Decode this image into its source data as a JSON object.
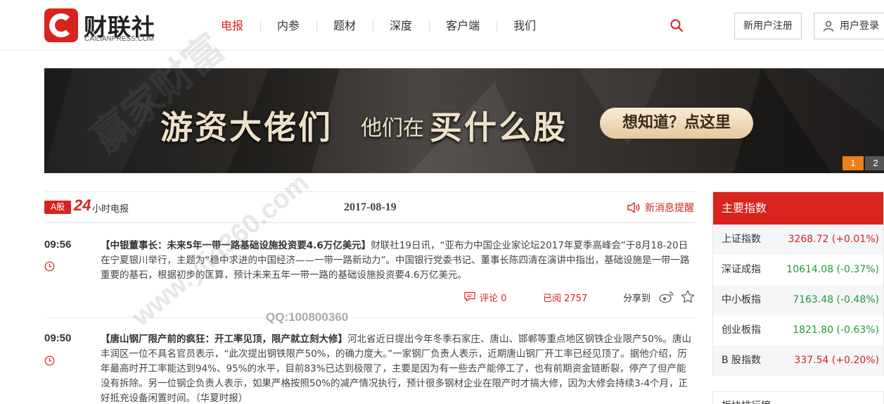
{
  "brand": {
    "name_cn": "财联社",
    "name_en": "CAILIANPRESS.COM",
    "accent": "#d8231e"
  },
  "nav": {
    "items": [
      {
        "label": "电报",
        "active": true
      },
      {
        "label": "内参"
      },
      {
        "label": "题材"
      },
      {
        "label": "深度"
      },
      {
        "label": "客户端"
      },
      {
        "label": "我们"
      }
    ],
    "search_icon": "search-icon",
    "register": "新用户注册",
    "login": "用户登录"
  },
  "banner": {
    "text1": "游资大佬们",
    "text2": "他们在",
    "text3": "买什么股",
    "cta": "想知道？点这里",
    "pages": [
      "1",
      "2"
    ],
    "active_page": 1
  },
  "telegraph": {
    "tag": "A股",
    "tag_num": "24",
    "tag_label": "小时电报",
    "date": "2017-08-19",
    "remind": "新消息提醒"
  },
  "news": [
    {
      "time": "09:56",
      "headline": "【中银董事长：未来5年一带一路基础设施投资要4.6万亿美元】",
      "body": "财联社19日讯，“亚布力中国企业家论坛2017年夏季高峰会”于8月18-20日在宁夏银川举行，主题为“稳中求进的中国经济——一带一路新动力”。中国银行党委书记、董事长陈四清在演讲中指出，基础设施是一带一路重要的基石，根据初步的匡算，预计未来五年一带一路的基础设施投资要4.6万亿美元。",
      "comment": "评论 0",
      "read": "已阅 2757",
      "share": "分享到"
    },
    {
      "time": "09:50",
      "headline": "【唐山钢厂限产前的疯狂：开工率见顶，限产就立刻大修】",
      "body": "河北省近日提出今年冬季石家庄、唐山、邯郸等重点地区钢铁企业限产50%。唐山丰润区一位不具名官员表示，“此次提出钢铁限产50%，的确力度大。”一家钢厂负责人表示，近期唐山钢厂开工率已经见顶了。据他介绍，历年最高时开工率能达到94%、95%的水平，目前83%已达到极限了，主要是因为有一些去产能停工了，也有前期资金链断裂，停产了但产能没有拆除。另一位钢企负责人表示，如果严格按照50%的减产情况执行，预计很多钢材企业在限产时才搞大修，因为大修会持续3-4个月，正好抵充设备闲置时间。（华夏时报）"
    }
  ],
  "watermark": {
    "qq": "QQ:100800360",
    "big": "赢家财富",
    "url": "www.yjia360.com"
  },
  "indices": {
    "title": "主要指数",
    "rows": [
      {
        "name": "上证指数",
        "value": "3268.72 (+0.01%)",
        "dir": "up"
      },
      {
        "name": "深证成指",
        "value": "10614.08 (-0.37%)",
        "dir": "down"
      },
      {
        "name": "中小板指",
        "value": "7163.48 (-0.48%)",
        "dir": "down"
      },
      {
        "name": "创业板指",
        "value": "1821.80 (-0.63%)",
        "dir": "down"
      },
      {
        "name": "B 股指数",
        "value": "337.54 (+0.20%)",
        "dir": "up"
      }
    ]
  },
  "panel2": {
    "title": "板块排行榜"
  }
}
